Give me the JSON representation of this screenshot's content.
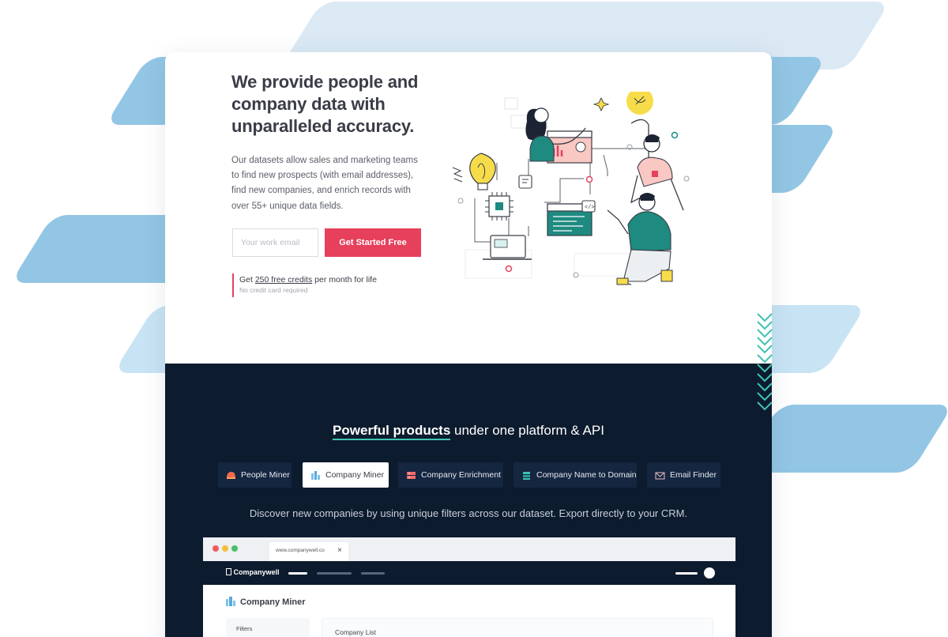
{
  "hero": {
    "title": "We provide people and company data with unparalleled accuracy.",
    "description": "Our datasets allow sales and marketing teams to find new prospects (with email addresses), find new companies, and enrich records with over 55+ unique data fields.",
    "email_placeholder": "Your work email",
    "cta_label": "Get Started Free",
    "credits_prefix": "Get ",
    "credits_link": "250 free credits",
    "credits_suffix": " per month for life",
    "credits_subtext": "No credit card required"
  },
  "products": {
    "title_highlight": "Powerful products",
    "title_rest": " under one platform & API",
    "tabs": [
      {
        "label": "People Miner",
        "icon": "helmet-icon",
        "active": false
      },
      {
        "label": "Company Miner",
        "icon": "buildings-icon",
        "active": true
      },
      {
        "label": "Company Enrichment",
        "icon": "database-icon",
        "active": false
      },
      {
        "label": "Company Name to Domain",
        "icon": "stack-icon",
        "active": false
      },
      {
        "label": "Email Finder",
        "icon": "envelope-icon",
        "active": false
      }
    ],
    "description": "Discover new companies by using unique filters across our dataset. Export directly to your CRM."
  },
  "browser_mock": {
    "tab_url": "www.companywell.co",
    "tab_close": "×",
    "logo": "Companywell",
    "page_title": "Company Miner",
    "filters_label": "Filters",
    "list_label": "Company List"
  },
  "colors": {
    "accent": "#e6405c",
    "dark_bg": "#0d1b2e",
    "teal": "#3fc3b1",
    "stripe_blue": "#93c6e4"
  }
}
